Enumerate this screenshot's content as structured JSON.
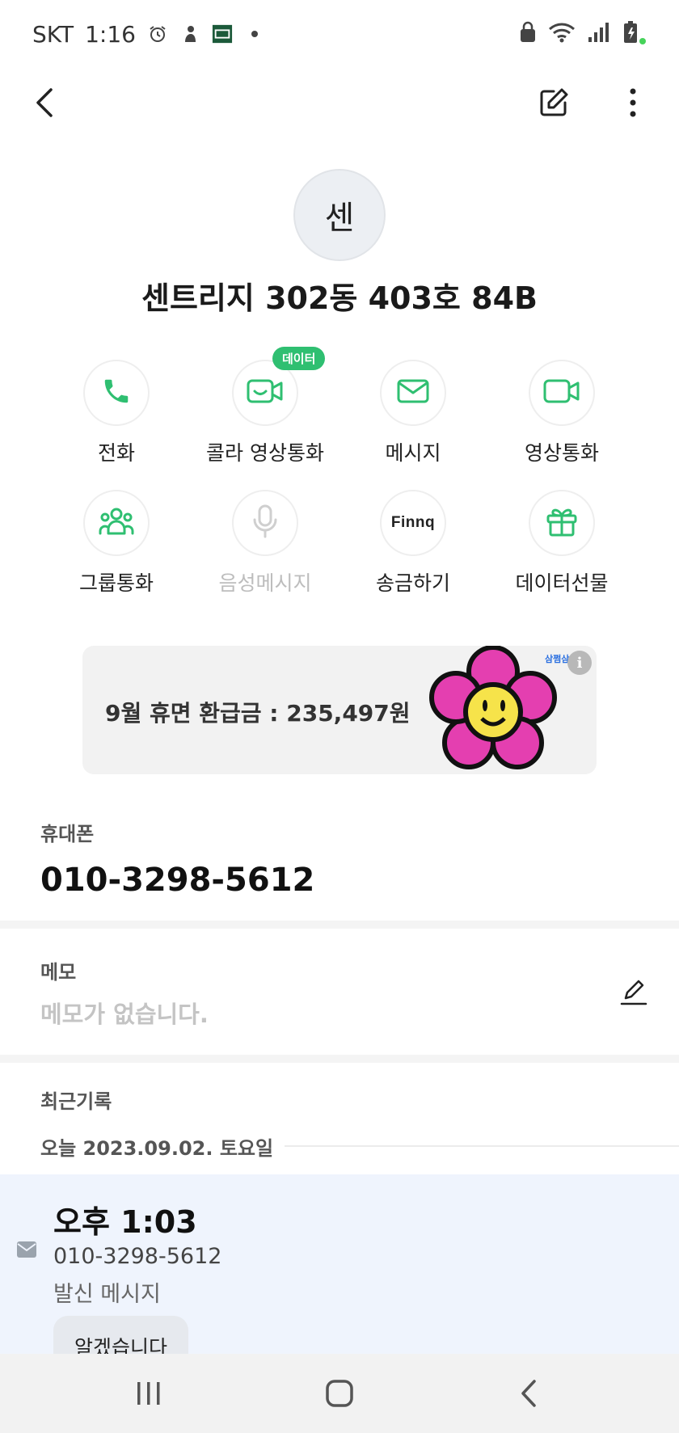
{
  "status_bar": {
    "carrier": "SKT",
    "time": "1:16",
    "left_icons": [
      "alarm-icon",
      "notification-icon",
      "card-icon",
      "dot-icon"
    ],
    "right_icons": [
      "lock-icon",
      "wifi-icon",
      "signal-icon",
      "battery-icon"
    ]
  },
  "app_bar": {
    "icons": [
      "back-icon",
      "edit-icon",
      "more-icon"
    ]
  },
  "contact": {
    "avatar_text": "센",
    "name": "센트리지 302동 403호  84B"
  },
  "actions": [
    {
      "label": "전화",
      "icon": "phone-icon",
      "enabled": true
    },
    {
      "label": "콜라 영상통화",
      "icon": "video-call-icon",
      "badge": "데이터",
      "enabled": true
    },
    {
      "label": "메시지",
      "icon": "mail-icon",
      "enabled": true
    },
    {
      "label": "영상통화",
      "icon": "video-icon",
      "enabled": true
    },
    {
      "label": "그룹통화",
      "icon": "group-icon",
      "enabled": true
    },
    {
      "label": "음성메시지",
      "icon": "mic-icon",
      "enabled": false
    },
    {
      "label": "송금하기",
      "icon": "finnq-logo",
      "logo_text": "Finnq",
      "enabled": true
    },
    {
      "label": "데이터선물",
      "icon": "gift-icon",
      "enabled": true
    }
  ],
  "ad": {
    "text": "9월 휴면 환급금 : 235,497원",
    "brand": "삼쩜삼",
    "info_symbol": "i"
  },
  "phone_section": {
    "label": "휴대폰",
    "number": "010-3298-5612"
  },
  "memo_section": {
    "label": "메모",
    "placeholder": "메모가 없습니다."
  },
  "history": {
    "label": "최근기록",
    "date": "오늘 2023.09.02. 토요일",
    "items": [
      {
        "time": "오후 1:03",
        "number": "010-3298-5612",
        "type": "발신 메시지",
        "message": "알겠습니다"
      }
    ]
  },
  "nav_bar": {
    "buttons": [
      "recents-icon",
      "home-icon",
      "back-nav-icon"
    ]
  },
  "colors": {
    "accent_green": "#2fbf71",
    "log_background": "#eff4fd"
  }
}
